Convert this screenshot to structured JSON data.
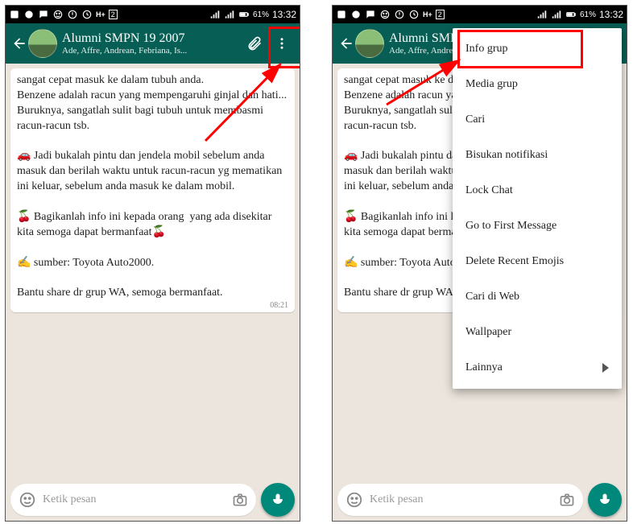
{
  "status": {
    "time": "13:32",
    "battery": "61%",
    "signal_strength": "full",
    "icons_left": [
      "plus",
      "bbm",
      "chat",
      "smiley",
      "exclaim",
      "clock",
      "H+",
      "sim2"
    ],
    "icons_right": [
      "signal1",
      "signal2",
      "battery",
      "clock"
    ]
  },
  "header": {
    "title": "Alumni SMPN 19 2007",
    "subtitle": "Ade, Affre, Andrean, Febriana, Is..."
  },
  "chat": {
    "bubble_text": "sangat cepat masuk ke dalam tubuh anda.\nBenzene adalah racun yang mempengaruhi ginjal dan hati... Buruknya, sangatlah sulit bagi tubuh untuk membasmi racun-racun tsb.\n\n🚗 Jadi bukalah pintu dan jendela mobil sebelum anda masuk dan berilah waktu untuk racun-racun yg mematikan ini keluar, sebelum anda masuk ke dalam mobil.\n\n🍒 Bagikanlah info ini kepada orang  yang ada disekitar kita semoga dapat bermanfaat🍒\n\n✍️ sumber: Toyota Auto2000.\n\nBantu share dr grup WA, semoga bermanfaat.",
    "time": "08:21"
  },
  "input": {
    "placeholder": "Ketik pesan"
  },
  "menu": {
    "items": [
      "Info grup",
      "Media grup",
      "Cari",
      "Bisukan notifikasi",
      "Lock Chat",
      "Go to First Message",
      "Delete Recent Emojis",
      "Cari di Web",
      "Wallpaper",
      "Lainnya"
    ]
  }
}
